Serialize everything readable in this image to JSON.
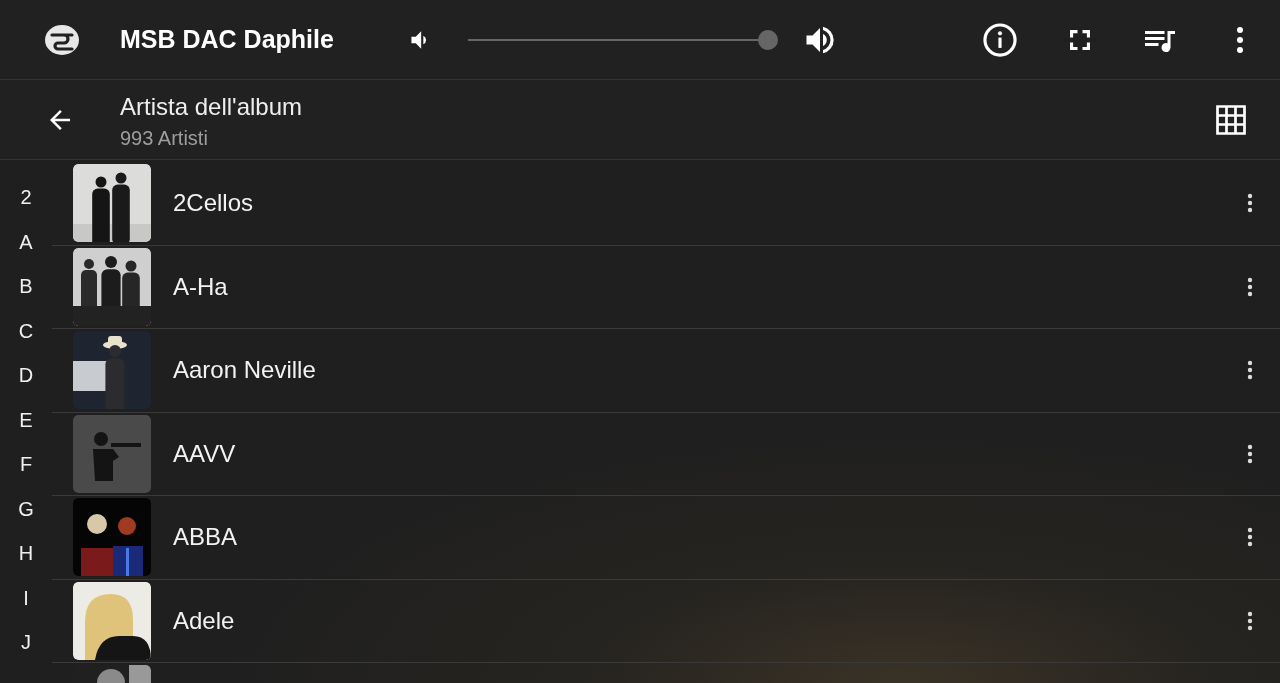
{
  "app_bar": {
    "title": "MSB DAC Daphile",
    "volume": {
      "level": 1
    }
  },
  "header": {
    "title": "Artista dell'album",
    "subtitle": "993 Artisti"
  },
  "index_letters": [
    "2",
    "A",
    "B",
    "C",
    "D",
    "E",
    "F",
    "G",
    "H",
    "I",
    "J"
  ],
  "artists": [
    {
      "kind": "artist",
      "name": "2Cellos"
    },
    {
      "kind": "artist",
      "name": "A-Ha"
    },
    {
      "kind": "artist",
      "name": "Aaron Neville"
    },
    {
      "kind": "artist",
      "name": "AAVV"
    },
    {
      "kind": "artist",
      "name": "ABBA"
    },
    {
      "kind": "artist",
      "name": "Adele"
    },
    {
      "kind": "picture"
    }
  ]
}
